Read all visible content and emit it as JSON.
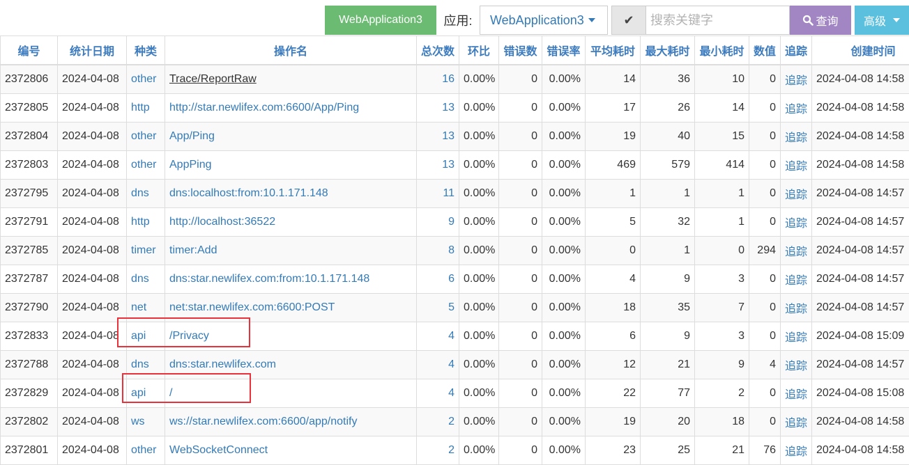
{
  "toolbar": {
    "app_pill": "WebApplication3",
    "app_label": "应用:",
    "app_select_value": "WebApplication3",
    "check_icon": "✔",
    "search_placeholder": "搜索关键字",
    "query_label": "查询",
    "advanced_label": "高级"
  },
  "table": {
    "headers": [
      "编号",
      "统计日期",
      "种类",
      "操作名",
      "总次数",
      "环比",
      "错误数",
      "错误率",
      "平均耗时",
      "最大耗时",
      "最小耗时",
      "数值",
      "追踪",
      "创建时间"
    ],
    "rows": [
      [
        "2372806",
        "2024-04-08",
        "other",
        "Trace/ReportRaw",
        "16",
        "0.00%",
        "0",
        "0.00%",
        "14",
        "36",
        "10",
        "0",
        "追踪",
        "2024-04-08 14:58"
      ],
      [
        "2372805",
        "2024-04-08",
        "http",
        "http://star.newlifex.com:6600/App/Ping",
        "13",
        "0.00%",
        "0",
        "0.00%",
        "17",
        "26",
        "14",
        "0",
        "追踪",
        "2024-04-08 14:58"
      ],
      [
        "2372804",
        "2024-04-08",
        "other",
        "App/Ping",
        "13",
        "0.00%",
        "0",
        "0.00%",
        "19",
        "40",
        "15",
        "0",
        "追踪",
        "2024-04-08 14:58"
      ],
      [
        "2372803",
        "2024-04-08",
        "other",
        "AppPing",
        "13",
        "0.00%",
        "0",
        "0.00%",
        "469",
        "579",
        "414",
        "0",
        "追踪",
        "2024-04-08 14:58"
      ],
      [
        "2372795",
        "2024-04-08",
        "dns",
        "dns:localhost:from:10.1.171.148",
        "11",
        "0.00%",
        "0",
        "0.00%",
        "1",
        "1",
        "1",
        "0",
        "追踪",
        "2024-04-08 14:57"
      ],
      [
        "2372791",
        "2024-04-08",
        "http",
        "http://localhost:36522",
        "9",
        "0.00%",
        "0",
        "0.00%",
        "5",
        "32",
        "1",
        "0",
        "追踪",
        "2024-04-08 14:57"
      ],
      [
        "2372785",
        "2024-04-08",
        "timer",
        "timer:Add",
        "8",
        "0.00%",
        "0",
        "0.00%",
        "0",
        "1",
        "0",
        "294",
        "追踪",
        "2024-04-08 14:57"
      ],
      [
        "2372787",
        "2024-04-08",
        "dns",
        "dns:star.newlifex.com:from:10.1.171.148",
        "6",
        "0.00%",
        "0",
        "0.00%",
        "4",
        "9",
        "3",
        "0",
        "追踪",
        "2024-04-08 14:57"
      ],
      [
        "2372790",
        "2024-04-08",
        "net",
        "net:star.newlifex.com:6600:POST",
        "5",
        "0.00%",
        "0",
        "0.00%",
        "18",
        "35",
        "7",
        "0",
        "追踪",
        "2024-04-08 14:57"
      ],
      [
        "2372833",
        "2024-04-08",
        "api",
        "/Privacy",
        "4",
        "0.00%",
        "0",
        "0.00%",
        "6",
        "9",
        "3",
        "0",
        "追踪",
        "2024-04-08 15:09"
      ],
      [
        "2372788",
        "2024-04-08",
        "dns",
        "dns:star.newlifex.com",
        "4",
        "0.00%",
        "0",
        "0.00%",
        "12",
        "21",
        "9",
        "4",
        "追踪",
        "2024-04-08 14:57"
      ],
      [
        "2372829",
        "2024-04-08",
        "api",
        "/",
        "4",
        "0.00%",
        "0",
        "0.00%",
        "22",
        "77",
        "2",
        "0",
        "追踪",
        "2024-04-08 15:08"
      ],
      [
        "2372802",
        "2024-04-08",
        "ws",
        "ws://star.newlifex.com:6600/app/notify",
        "2",
        "0.00%",
        "0",
        "0.00%",
        "19",
        "20",
        "18",
        "0",
        "追踪",
        "2024-04-08 14:58"
      ],
      [
        "2372801",
        "2024-04-08",
        "other",
        "WebSocketConnect",
        "2",
        "0.00%",
        "0",
        "0.00%",
        "23",
        "25",
        "21",
        "76",
        "追踪",
        "2024-04-08 14:58"
      ]
    ]
  },
  "colors": {
    "header_text": "#3c7bbe",
    "link": "#337ab7",
    "highlight": "#e8313a"
  }
}
